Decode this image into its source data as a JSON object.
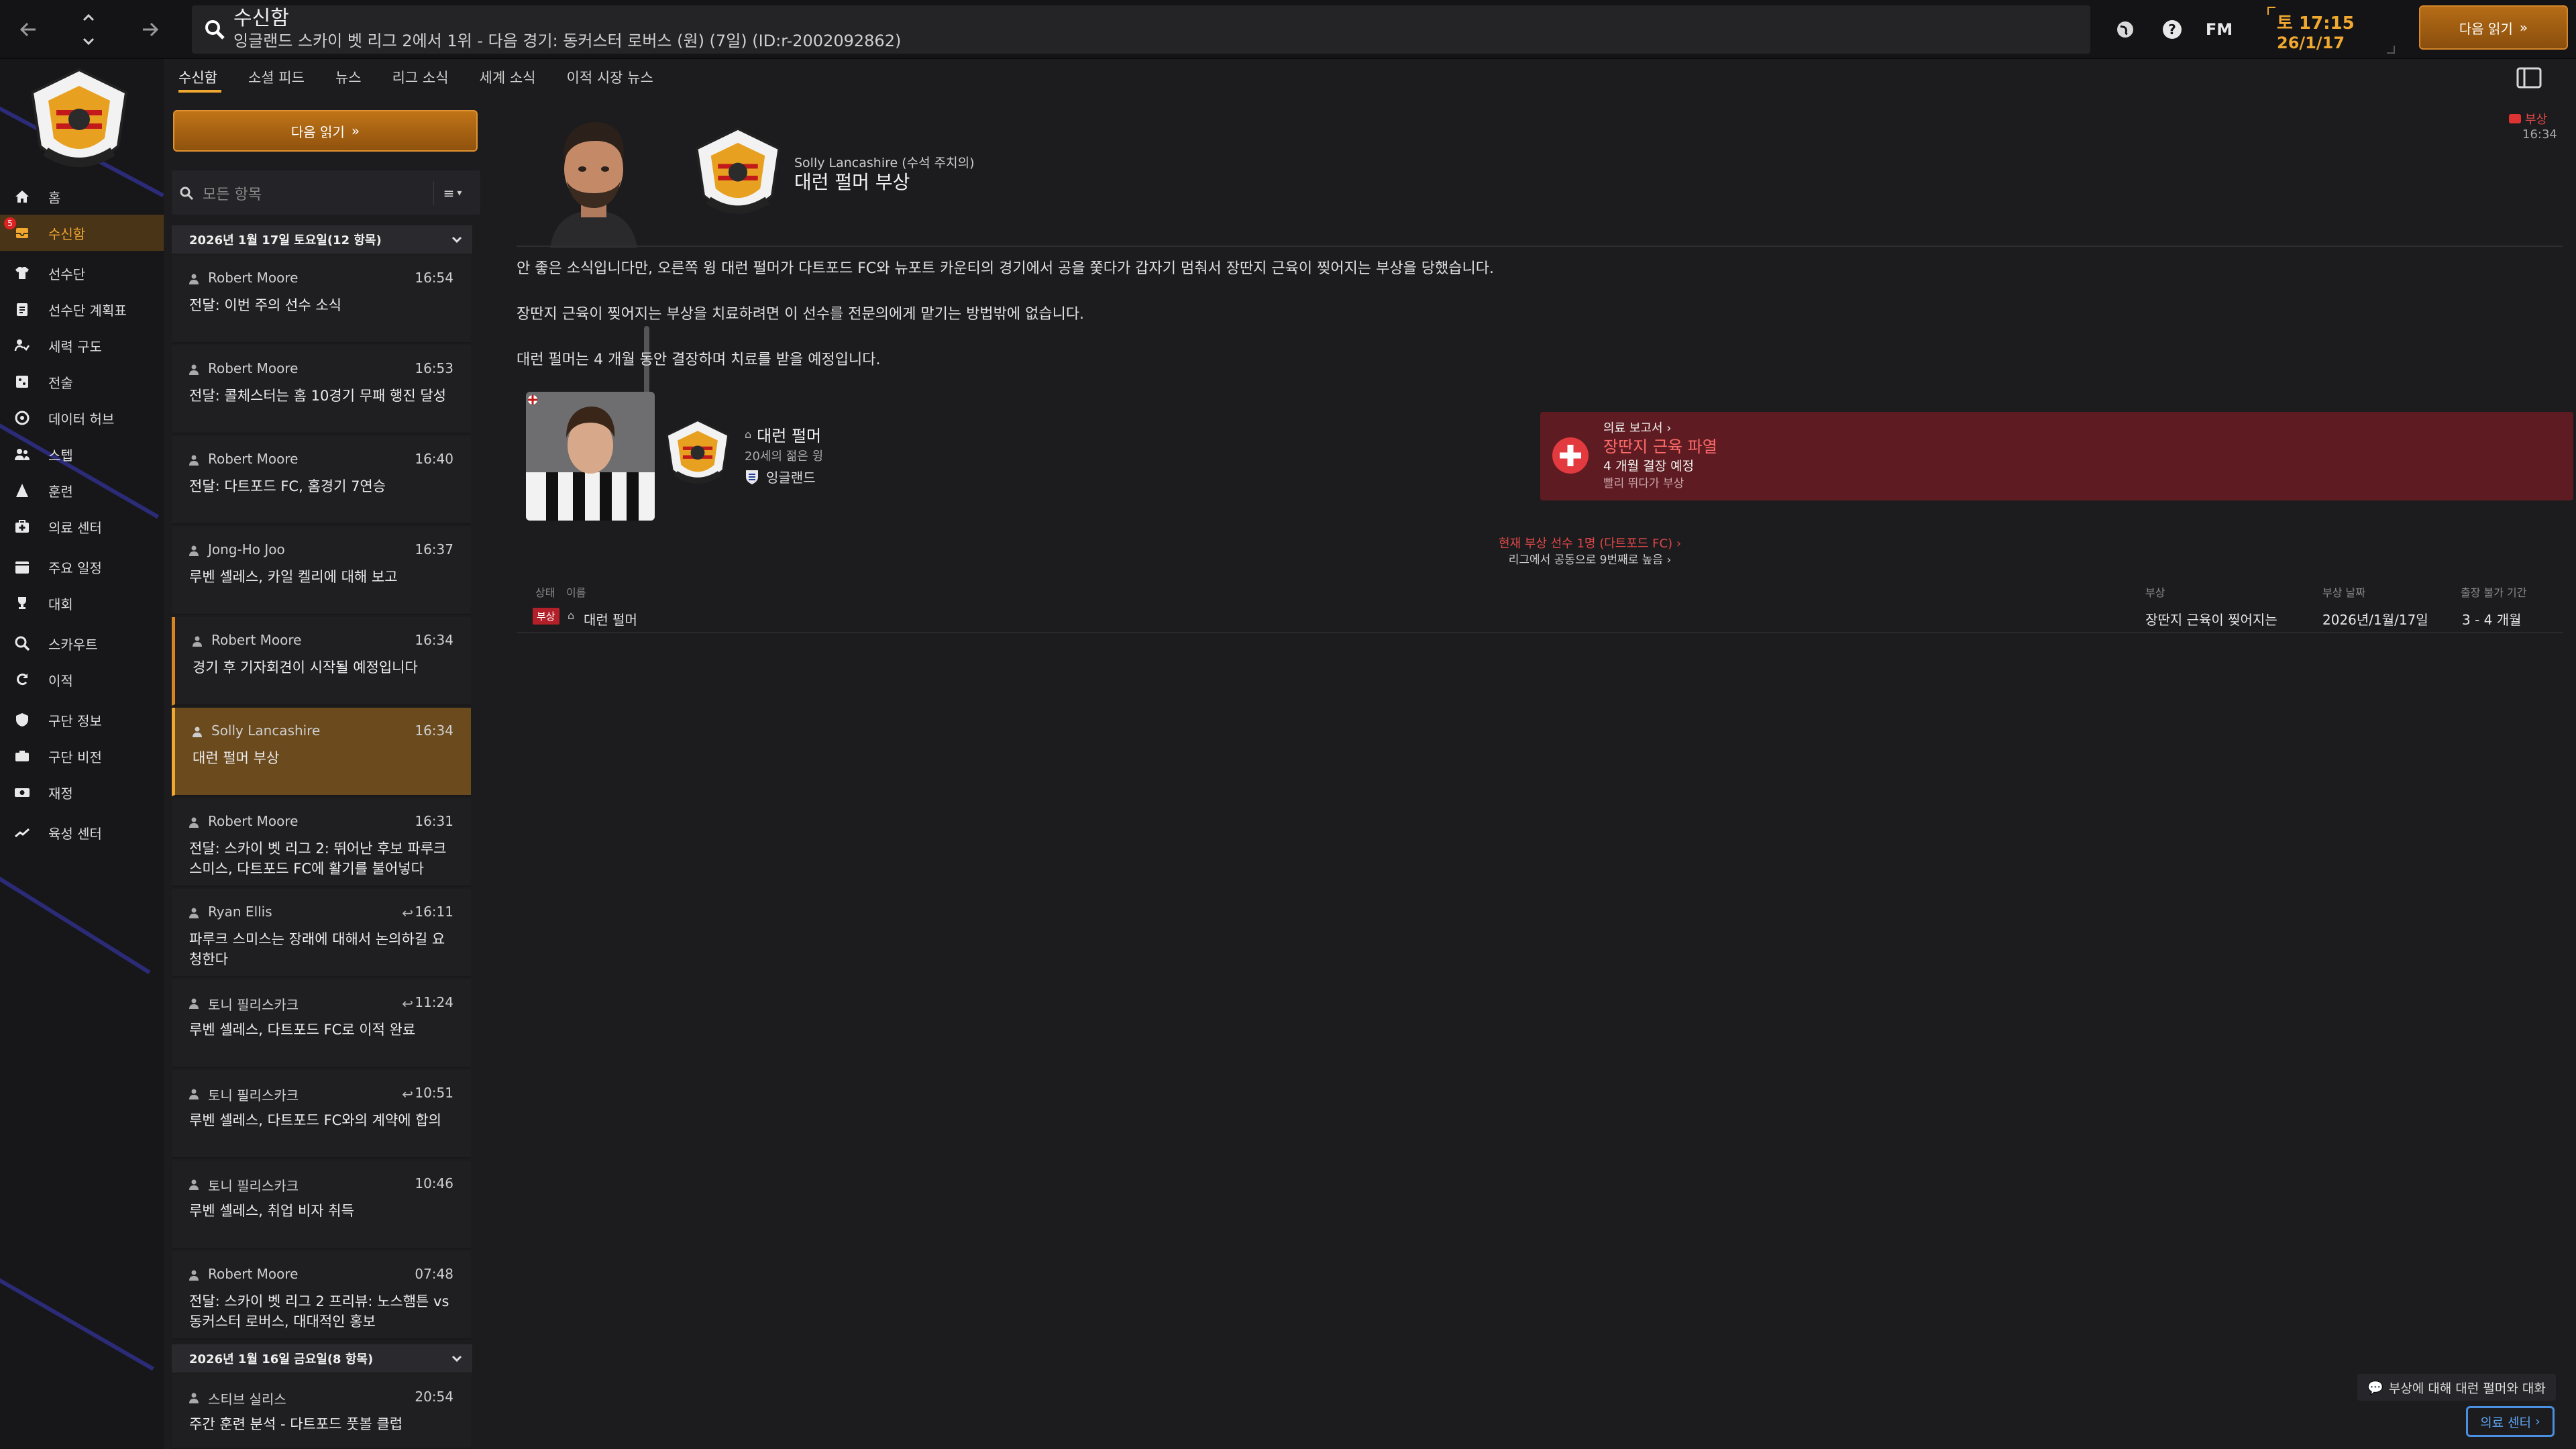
{
  "topbar": {
    "title": "수신함",
    "subtitle": "잉글랜드 스카이 벳 리그 2에서 1위 - 다음 경기: 동커스터 로버스 (원) (7일) (ID:r-2002092862)",
    "fm_logo": "FM",
    "date_line1": "토 17:15",
    "date_line2": "26/1/17",
    "continue_label": "다음 읽기"
  },
  "sidebar": {
    "items": [
      {
        "label": "홈",
        "icon": "home-icon"
      },
      {
        "label": "수신함",
        "icon": "inbox-icon",
        "badge": "5"
      },
      {
        "label": "선수단",
        "icon": "shirt-icon"
      },
      {
        "label": "선수단 계획표",
        "icon": "clipboard-icon"
      },
      {
        "label": "세력 구도",
        "icon": "dynamics-icon"
      },
      {
        "label": "전술",
        "icon": "tactics-icon"
      },
      {
        "label": "데이터 허브",
        "icon": "data-hub-icon"
      },
      {
        "label": "스텝",
        "icon": "staff-icon"
      },
      {
        "label": "훈련",
        "icon": "training-icon"
      },
      {
        "label": "의료 센터",
        "icon": "medical-icon"
      },
      {
        "label": "주요 일정",
        "icon": "calendar-icon"
      },
      {
        "label": "대회",
        "icon": "trophy-icon"
      },
      {
        "label": "스카우트",
        "icon": "scout-icon"
      },
      {
        "label": "이적",
        "icon": "transfer-icon"
      },
      {
        "label": "구단 정보",
        "icon": "club-info-icon"
      },
      {
        "label": "구단 비전",
        "icon": "club-vision-icon"
      },
      {
        "label": "재정",
        "icon": "finance-icon"
      },
      {
        "label": "육성 센터",
        "icon": "development-icon"
      }
    ]
  },
  "subtabs": [
    "수신함",
    "소셜 피드",
    "뉴스",
    "리그 소식",
    "세계 소식",
    "이적 시장 뉴스"
  ],
  "list": {
    "continue_label": "다음 읽기",
    "filter_placeholder": "모든 항목",
    "filter_menu": "≡",
    "group1": "2026년 1월 17일 토요일(12 항목)",
    "group2": "2026년 1월 16일 금요일(8 항목)",
    "messages": [
      {
        "sender": "Robert Moore",
        "time": "16:54",
        "subject": "전달: 이번 주의 선수 소식"
      },
      {
        "sender": "Robert Moore",
        "time": "16:53",
        "subject": "전달: 콜체스터는 홈 10경기 무패 행진 달성"
      },
      {
        "sender": "Robert Moore",
        "time": "16:40",
        "subject": "전달: 다트포드 FC, 홈경기 7연승"
      },
      {
        "sender": "Jong-Ho Joo",
        "time": "16:37",
        "subject": "루벤 셀레스, 카일 켈리에 대해 보고"
      },
      {
        "sender": "Robert Moore",
        "time": "16:34",
        "subject": "경기 후 기자회견이 시작될 예정입니다"
      },
      {
        "sender": "Solly Lancashire",
        "time": "16:34",
        "subject": "대런 펄머 부상"
      },
      {
        "sender": "Robert Moore",
        "time": "16:31",
        "subject": "전달: 스카이 벳 리그 2: 뛰어난 후보 파루크 스미스, 다트포드 FC에 활기를 불어넣다"
      },
      {
        "sender": "Ryan Ellis",
        "time": "16:11",
        "subject": "파루크 스미스는 장래에 대해서 논의하길 요청한다"
      },
      {
        "sender": "토니 필리스카크",
        "time": "11:24",
        "subject": "루벤 셀레스, 다트포드 FC로 이적 완료"
      },
      {
        "sender": "토니 필리스카크",
        "time": "10:51",
        "subject": "루벤 셀레스, 다트포드 FC와의 계약에 합의"
      },
      {
        "sender": "토니 필리스카크",
        "time": "10:46",
        "subject": "루벤 셀레스, 취업 비자 취득"
      },
      {
        "sender": "Robert Moore",
        "time": "07:48",
        "subject": "전달: 스카이 벳 리그 2 프리뷰: 노스햄튼 vs 동커스터 로버스, 대대적인 홍보"
      },
      {
        "sender": "스티브 실리스",
        "time": "20:54",
        "subject": "주간 훈련 분석 - 다트포드 풋볼 클럽"
      }
    ]
  },
  "main": {
    "tag": "부상",
    "time": "16:34",
    "from": "Solly Lancashire (수석 주치의)",
    "title": "대런 펄머 부상",
    "p1": "안 좋은 소식입니다만, 오른쪽 윙 대런 펄머가 다트포드 FC와 뉴포트 카운티의 경기에서 공을 쫓다가 갑자기 멈춰서 장딴지 근육이 찢어지는 부상을 당했습니다.",
    "p2": "장딴지 근육이 찢어지는 부상을 치료하려면 이 선수를 전문의에게 맡기는 방법밖에 없습니다.",
    "p3": "대런 펄머는 4 개월 동안 결장하며 치료를 받을 예정입니다.",
    "player": {
      "name": "대런 펄머",
      "age": "20세의 젊은 윙",
      "nationality": "잉글랜드"
    },
    "medical": {
      "header": "의료 보고서",
      "diagnosis": "장딴지 근육 파열",
      "out": "4 개월 결장 예정",
      "note": "빨리 뛰다가 부상"
    },
    "injury_count": "현재 부상 선수 1명 (다트포드 FC)",
    "league_rank": "리그에서 공동으로 9번째로 높음",
    "table": {
      "headers": [
        "상태",
        "이름",
        "부상",
        "부상 날짜",
        "출장 불가 기간"
      ],
      "row": {
        "status": "부상",
        "name": "대런 펄머",
        "injury": "장딴지 근육이 찢어지는",
        "date": "2026년/1월/17일",
        "period": "3 - 4 개월"
      }
    },
    "chat_label": "부상에 대해 대런 펄머와 대화",
    "medcenter_label": "의료 센터"
  },
  "colors": {
    "accent": "#f0a830",
    "injury": "#e04848",
    "medical_card": "#5e1c22",
    "link_blue": "#5ea2f0"
  }
}
